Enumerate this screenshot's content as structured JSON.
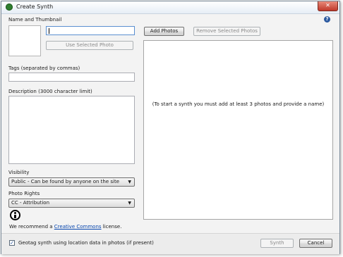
{
  "window": {
    "title": "Create Synth",
    "close_glyph": "✕",
    "help_glyph": "?"
  },
  "form": {
    "name_label": "Name and Thumbnail",
    "name_value": "",
    "use_photo_label": "Use Selected Photo",
    "tags_label": "Tags (separated by commas)",
    "tags_value": "",
    "description_label": "Description (3000 character limit)",
    "description_value": "",
    "visibility_label": "Visibility",
    "visibility_selected": "Public - Can be found by anyone on the site",
    "rights_label": "Photo Rights",
    "rights_selected": "CC - Attribution",
    "recommend_prefix": "We recommend a ",
    "recommend_link": "Creative Commons",
    "recommend_suffix": " license.",
    "dropdown_arrow": "▼"
  },
  "photos": {
    "add_label": "Add Photos",
    "remove_label": "Remove Selected Photos",
    "empty_message": "(To start a synth you must add at least 3 photos and provide a name)"
  },
  "footer": {
    "geotag_checked": true,
    "checkbox_glyph": "✓",
    "geotag_label": "Geotag synth using location data in photos (if present)",
    "synth_label": "Synth",
    "cancel_label": "Cancel"
  },
  "icons": {
    "app": "photosynth-app-icon",
    "close": "close-icon",
    "help": "help-icon",
    "cc": "creative-commons-attribution-icon",
    "dropdown": "chevron-down-icon",
    "check": "checkmark-icon"
  },
  "colors": {
    "link": "#0645ad",
    "close_button": "#c0392b",
    "help_icon": "#2c5aa0",
    "app_icon": "#2f7d2f"
  }
}
